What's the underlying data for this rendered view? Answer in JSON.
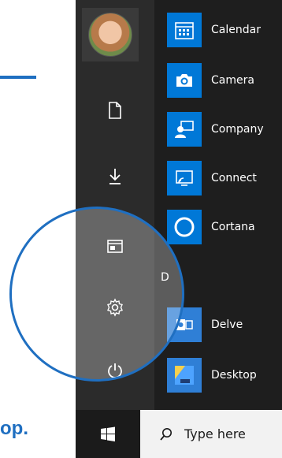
{
  "footer_text": "op.",
  "rail": {
    "items": [
      {
        "name": "documents-icon"
      },
      {
        "name": "downloads-icon"
      },
      {
        "name": "file-explorer-icon"
      },
      {
        "name": "settings-icon"
      },
      {
        "name": "power-icon"
      }
    ]
  },
  "section_letter": "D",
  "apps": [
    {
      "label": "Calendar",
      "icon": "calendar-icon"
    },
    {
      "label": "Camera",
      "icon": "camera-icon"
    },
    {
      "label": "Company",
      "icon": "company-portal-icon"
    },
    {
      "label": "Connect",
      "icon": "connect-icon"
    },
    {
      "label": "Cortana",
      "icon": "cortana-icon"
    },
    {
      "label": "Delve",
      "icon": "delve-icon"
    },
    {
      "label": "Desktop",
      "icon": "desktop-icon"
    }
  ],
  "taskbar": {
    "search_placeholder": "Type here"
  },
  "colors": {
    "accent": "#0078d7",
    "highlight": "#1f6fc1"
  }
}
